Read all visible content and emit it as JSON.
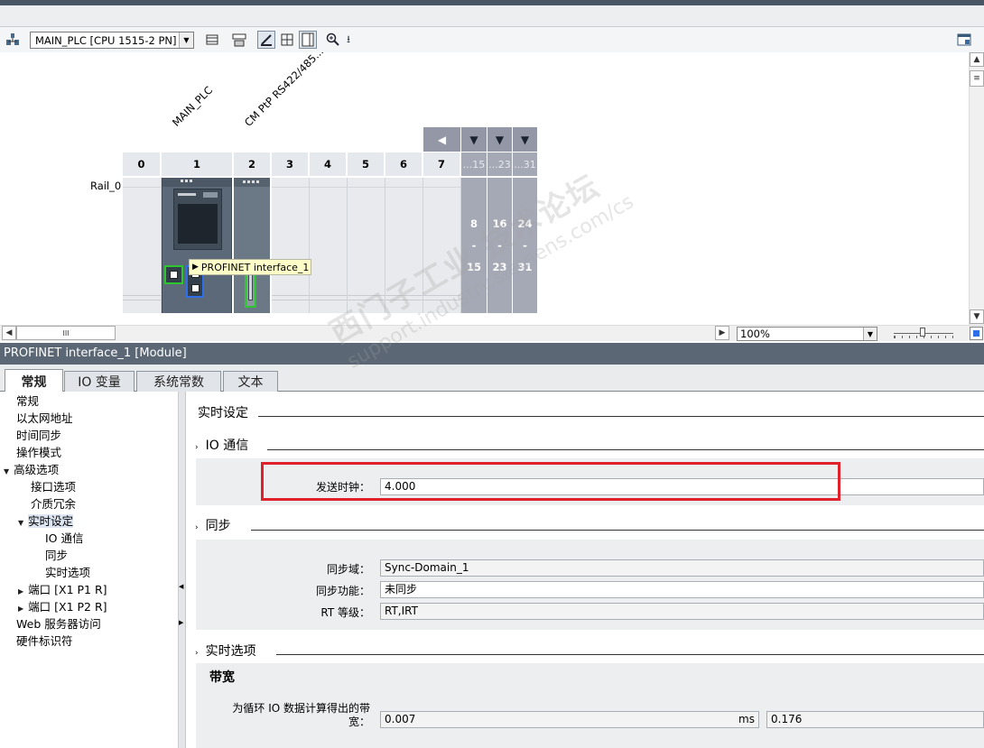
{
  "toolbar": {
    "device_select": "MAIN_PLC [CPU 1515-2 PN]",
    "icons": [
      "network-view-icon",
      "device-select-dropdown",
      "module-view-icon",
      "show-names-icon",
      "edit-icon",
      "grid-icon",
      "overview-icon",
      "zoom-icon",
      "download-icon",
      "properties-icon"
    ]
  },
  "device_view": {
    "labels": {
      "cpu": "MAIN_PLC",
      "cm": "CM PtP RS422/485..."
    },
    "rail": "Rail_0",
    "slots": [
      "0",
      "1",
      "2",
      "3",
      "4",
      "5",
      "6",
      "7"
    ],
    "expansion_headers": [
      "...15",
      "...23",
      "...31"
    ],
    "expansion_ranges": [
      {
        "from": "8",
        "dash": "-",
        "to": "15"
      },
      {
        "from": "16",
        "dash": "-",
        "to": "23"
      },
      {
        "from": "24",
        "dash": "-",
        "to": "31"
      }
    ],
    "tooltip": "PROFINET interface_1"
  },
  "hscroll": {
    "grip": "III",
    "zoom": "100%"
  },
  "inspector": {
    "title": "PROFINET interface_1 [Module]",
    "tabs": [
      "常规",
      "IO 变量",
      "系统常数",
      "文本"
    ],
    "nav": [
      {
        "label": "常规",
        "level": 0,
        "tri": ""
      },
      {
        "label": "以太网地址",
        "level": 0,
        "tri": ""
      },
      {
        "label": "时间同步",
        "level": 0,
        "tri": ""
      },
      {
        "label": "操作模式",
        "level": 0,
        "tri": ""
      },
      {
        "label": "高级选项",
        "level": 0,
        "tri": "▼"
      },
      {
        "label": "接口选项",
        "level": 1,
        "tri": ""
      },
      {
        "label": "介质冗余",
        "level": 1,
        "tri": ""
      },
      {
        "label": "实时设定",
        "level": 1,
        "tri": "▼"
      },
      {
        "label": "IO 通信",
        "level": 2,
        "tri": ""
      },
      {
        "label": "同步",
        "level": 2,
        "tri": ""
      },
      {
        "label": "实时选项",
        "level": 2,
        "tri": ""
      },
      {
        "label": "端口 [X1 P1 R]",
        "level": 1,
        "tri": "▶"
      },
      {
        "label": "端口 [X1 P2 R]",
        "level": 1,
        "tri": "▶"
      },
      {
        "label": "Web 服务器访问",
        "level": 0,
        "tri": ""
      },
      {
        "label": "硬件标识符",
        "level": 0,
        "tri": ""
      }
    ],
    "content": {
      "section_main": "实时设定",
      "io": {
        "title": "IO 通信",
        "send_clock_label": "发送时钟：",
        "send_clock_value": "4.000"
      },
      "sync": {
        "title": "同步",
        "domain_label": "同步域：",
        "domain_value": "Sync-Domain_1",
        "func_label": "同步功能：",
        "func_value": "未同步",
        "rt_label": "RT 等级：",
        "rt_value": "RT,IRT"
      },
      "rt_options": {
        "title": "实时选项",
        "bandwidth_title": "带宽",
        "calc_label_1": "为循环 IO 数据计算得出的带",
        "calc_label_2": "宽：",
        "calc_value": "0.007",
        "calc_unit": "ms",
        "calc_value2": "0.176"
      }
    }
  },
  "watermark": {
    "line1": "西门子工业 技术论坛",
    "line2": "support.industry.siemens.com/cs"
  }
}
